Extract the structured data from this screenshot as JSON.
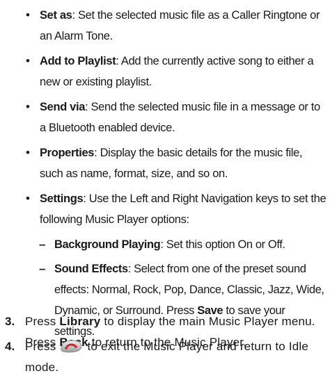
{
  "bullets": [
    {
      "term": "Set as",
      "desc": ": Set the selected music file as a Caller Ringtone or an Alarm Tone."
    },
    {
      "term": "Add to Playlist",
      "desc": ": Add the currently active song to either a new or existing playlist."
    },
    {
      "term": "Send via",
      "desc": ": Send the selected music file in a message or to a Bluetooth enabled device."
    },
    {
      "term": "Properties",
      "desc": ": Display the basic details for the music file, such as name, format, size, and so on."
    },
    {
      "term": "Settings",
      "desc": ": Use the Left and Right Navigation keys to set the following Music Player options:"
    }
  ],
  "sub_bullets": [
    {
      "term": "Background Playing",
      "desc": ": Set this option On or Off."
    },
    {
      "term": "Sound Effects",
      "desc": ": Select from one of the preset sound effects: Normal, Rock, Pop, Dance, Classic, Jazz, Wide, Dynamic, or Surround. Press ",
      "key": "Save",
      "tail": " to save your settings."
    }
  ],
  "steps": [
    {
      "num": "3.",
      "pre": "Press ",
      "key1": "Library",
      "mid": " to display the main Music Player menu. Press ",
      "key2": "Back",
      "post": " to return to the Music Player."
    },
    {
      "num": "4.",
      "pre": "Press",
      "post": "to exit the Music Player and return to Idle mode.",
      "icon": "end-call-key-icon"
    }
  ],
  "bullet_symbol": "•",
  "dash_symbol": "–",
  "colors": {
    "text": "#1a1a1a",
    "end_key": "#d0232a"
  }
}
